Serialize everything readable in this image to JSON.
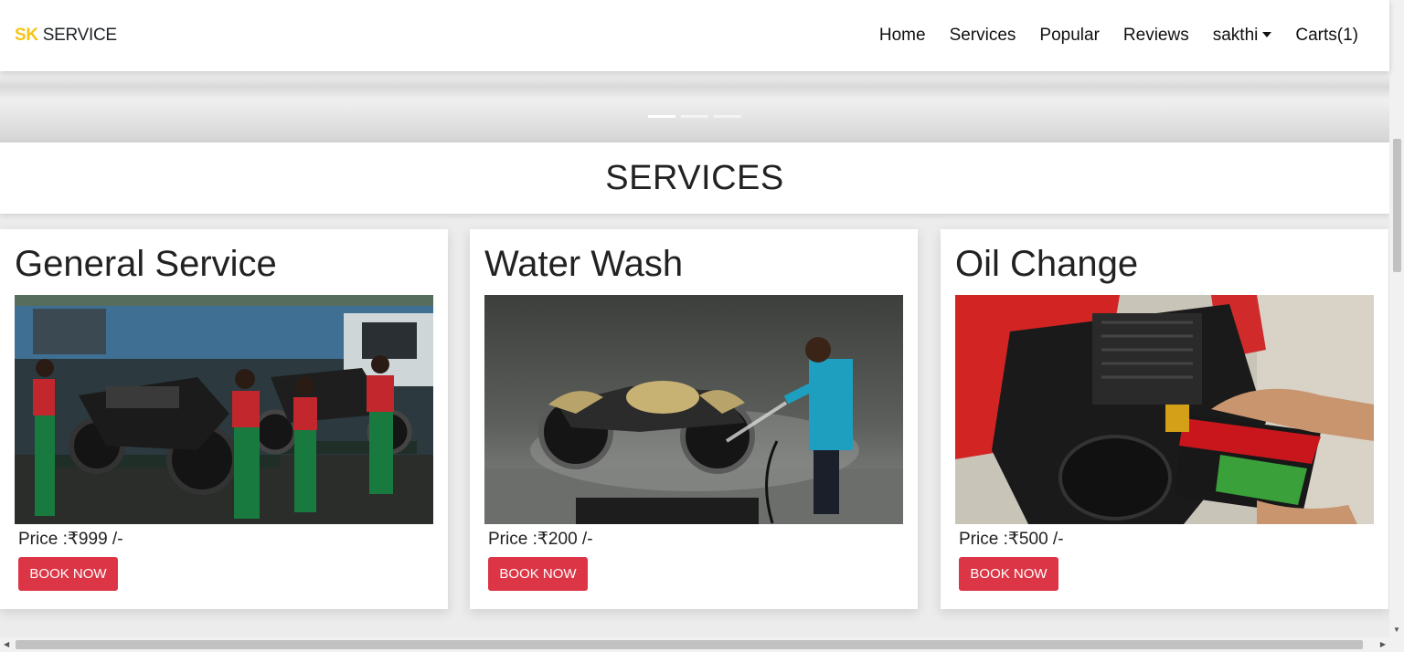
{
  "navbar": {
    "brand_accent": "SK",
    "brand_rest": " SERVICE",
    "links": {
      "home": "Home",
      "services": "Services",
      "popular": "Popular",
      "reviews": "Reviews",
      "user": "sakthi",
      "carts": "Carts(1)"
    }
  },
  "carousel": {
    "active_index": 0,
    "count": 3
  },
  "services": {
    "heading": "SERVICES",
    "cards": [
      {
        "title": "General Service",
        "price": "Price :₹999 /-",
        "button": "BOOK NOW"
      },
      {
        "title": "Water Wash",
        "price": "Price :₹200 /-",
        "button": "BOOK NOW"
      },
      {
        "title": "Oil Change",
        "price": "Price :₹500 /-",
        "button": "BOOK NOW"
      }
    ]
  },
  "colors": {
    "brand_accent": "#f5c518",
    "button": "#dc3545"
  }
}
